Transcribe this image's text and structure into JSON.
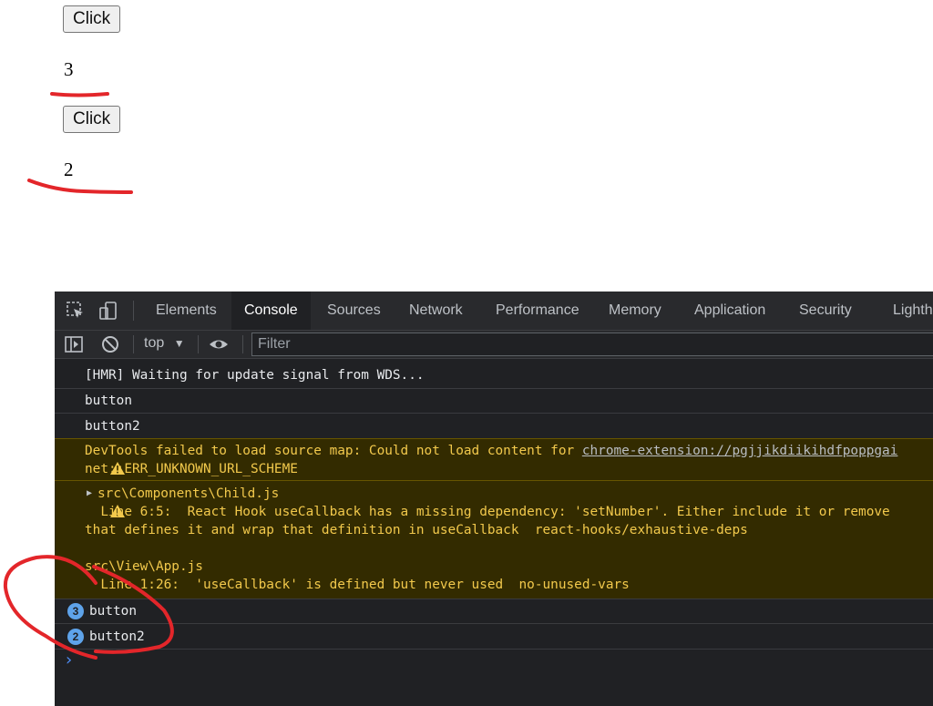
{
  "page": {
    "button1_label": "Click",
    "count1": "3",
    "button2_label": "Click",
    "count2": "2"
  },
  "devtools": {
    "tabs": [
      "Elements",
      "Console",
      "Sources",
      "Network",
      "Performance",
      "Memory",
      "Application",
      "Security",
      "Lighth"
    ],
    "active_tab": "Console",
    "toolbar": {
      "context": "top",
      "filter_placeholder": "Filter"
    },
    "messages": {
      "hmr": "[HMR] Waiting for update signal from WDS...",
      "log1": "button",
      "log2": "button2",
      "sourcemap_warning_line1": "DevTools failed to load source map: Could not load content for ",
      "sourcemap_link": "chrome-extension://pgjjikdiikihdfpoppgai",
      "sourcemap_warning_line2": "net::ERR_UNKNOWN_URL_SCHEME",
      "eslint_file1": "src\\Components\\Child.js",
      "eslint_line1": "  Line 6:5:  React Hook useCallback has a missing dependency: 'setNumber'. Either include it or remove",
      "eslint_line2": "that defines it and wrap that definition in useCallback  react-hooks/exhaustive-deps",
      "eslint_file2": "src\\View\\App.js",
      "eslint_line3": "  Line 1:26:  'useCallback' is defined but never used  no-unused-vars",
      "grouped1_count": "3",
      "grouped1_text": "button",
      "grouped2_count": "2",
      "grouped2_text": "button2"
    },
    "prompt_symbol": "›"
  },
  "colors": {
    "annotation": "#e3262a",
    "warning_bg": "#332b00",
    "warning_text": "#f2c94c",
    "badge": "#5ea3ea"
  }
}
